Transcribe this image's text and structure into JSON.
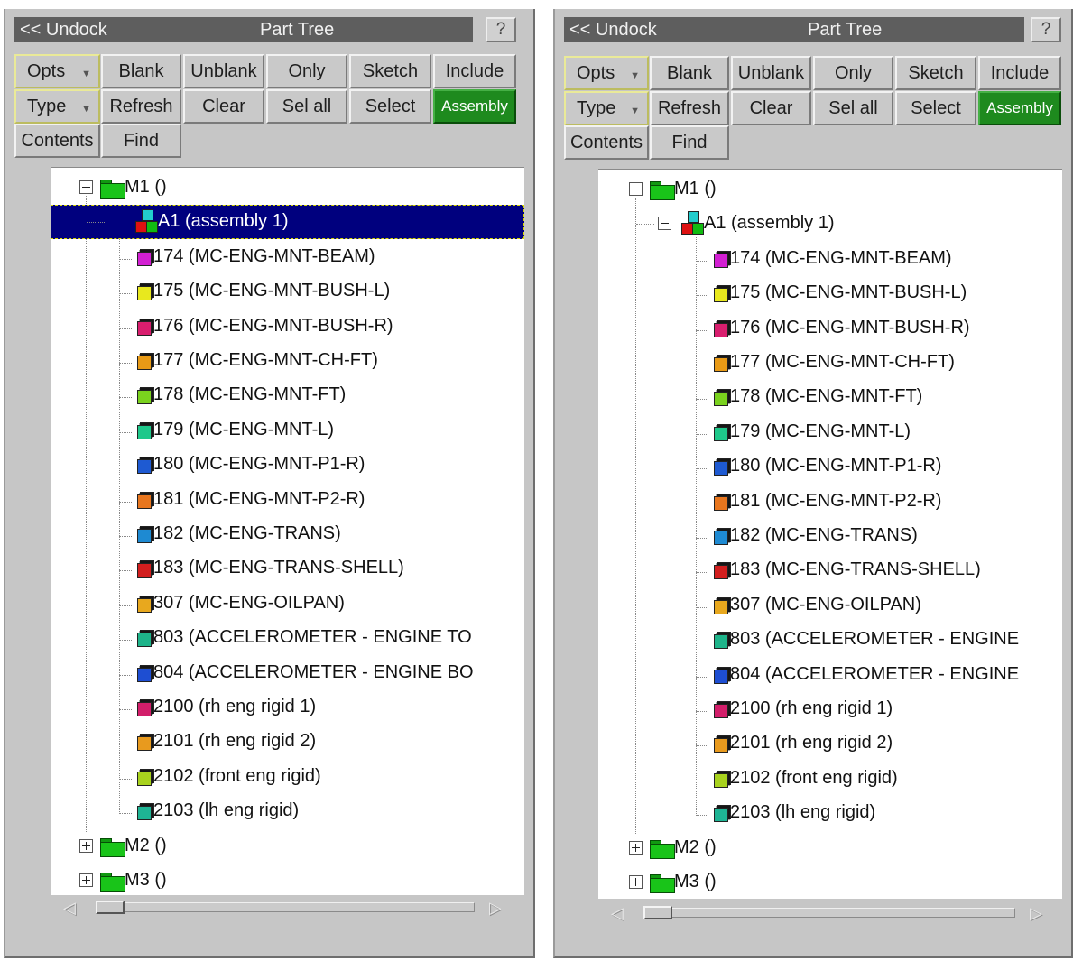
{
  "window": {
    "undock_label": "<< Undock",
    "title": "Part Tree",
    "help_label": "?"
  },
  "toolbar": {
    "opts": "Opts",
    "type": "Type",
    "contents": "Contents",
    "blank": "Blank",
    "unblank": "Unblank",
    "only": "Only",
    "sketch": "Sketch",
    "include": "Include",
    "refresh": "Refresh",
    "clear": "Clear",
    "sel_all": "Sel all",
    "select": "Select",
    "assembly": "Assembly",
    "find": "Find",
    "dropdown_arrow": "▼"
  },
  "tree": {
    "models": [
      {
        "label": "M1 ()"
      },
      {
        "label": "M2 ()"
      },
      {
        "label": "M3 ()"
      }
    ],
    "assembly": {
      "label": "A1 (assembly 1)"
    },
    "parts_left": [
      {
        "label": "174 (MC-ENG-MNT-BEAM)",
        "color": "#d21fd2"
      },
      {
        "label": "175 (MC-ENG-MNT-BUSH-L)",
        "color": "#e8e81e"
      },
      {
        "label": "176 (MC-ENG-MNT-BUSH-R)",
        "color": "#d81e6e"
      },
      {
        "label": "177 (MC-ENG-MNT-CH-FT)",
        "color": "#e89a16"
      },
      {
        "label": "178 (MC-ENG-MNT-FT)",
        "color": "#7ad21e"
      },
      {
        "label": "179 (MC-ENG-MNT-L)",
        "color": "#1ec88a"
      },
      {
        "label": "180 (MC-ENG-MNT-P1-R)",
        "color": "#1e5ad2"
      },
      {
        "label": "181 (MC-ENG-MNT-P2-R)",
        "color": "#e8761e"
      },
      {
        "label": "182 (MC-ENG-TRANS)",
        "color": "#1e8ad2"
      },
      {
        "label": "183 (MC-ENG-TRANS-SHELL)",
        "color": "#d21e1e"
      },
      {
        "label": "307 (MC-ENG-OILPAN)",
        "color": "#e8a81e"
      },
      {
        "label": "803 (ACCELEROMETER -  ENGINE TO",
        "color": "#1eb48a"
      },
      {
        "label": "804 (ACCELEROMETER -  ENGINE BO",
        "color": "#1e4ed2"
      },
      {
        "label": "2100 (rh eng rigid 1)",
        "color": "#d21e6a"
      },
      {
        "label": "2101 (rh eng rigid 2)",
        "color": "#e89a1e"
      },
      {
        "label": "2102 (front eng rigid)",
        "color": "#a8d21e"
      },
      {
        "label": "2103 (lh eng rigid)",
        "color": "#1eb494"
      }
    ],
    "parts_right": [
      {
        "label": "174 (MC-ENG-MNT-BEAM)"
      },
      {
        "label": "175 (MC-ENG-MNT-BUSH-L)"
      },
      {
        "label": "176 (MC-ENG-MNT-BUSH-R)"
      },
      {
        "label": "177 (MC-ENG-MNT-CH-FT)"
      },
      {
        "label": "178 (MC-ENG-MNT-FT)"
      },
      {
        "label": "179 (MC-ENG-MNT-L)"
      },
      {
        "label": "180 (MC-ENG-MNT-P1-R)"
      },
      {
        "label": "181 (MC-ENG-MNT-P2-R)"
      },
      {
        "label": "182 (MC-ENG-TRANS)"
      },
      {
        "label": "183 (MC-ENG-TRANS-SHELL)"
      },
      {
        "label": "307 (MC-ENG-OILPAN)"
      },
      {
        "label": "803 (ACCELEROMETER -  ENGINE"
      },
      {
        "label": "804 (ACCELEROMETER -  ENGINE"
      },
      {
        "label": "2100 (rh eng rigid 1)"
      },
      {
        "label": "2101 (rh eng rigid 2)"
      },
      {
        "label": "2102 (front eng rigid)"
      },
      {
        "label": "2103 (lh eng rigid)"
      }
    ]
  },
  "scrollbar": {
    "left_arrow": "◁",
    "right_arrow": "▷"
  },
  "colors": {
    "assembly_active": "#1e8a1e",
    "selection": "#00007e",
    "folder": "#19c419"
  },
  "panels": [
    {
      "state": "assembly selected"
    },
    {
      "state": "assembly expanded"
    }
  ]
}
